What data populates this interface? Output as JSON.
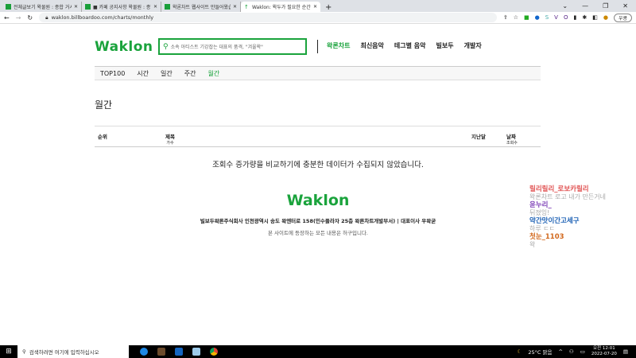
{
  "browser": {
    "tabs": [
      {
        "title": "전체글보기 왁물원 : 종합 거시기"
      },
      {
        "title": "■ 카페 공지사항 왁물원 : 종합"
      },
      {
        "title": "왁론차트 웹사이트 만들어왔습니"
      },
      {
        "title": "Waklon: 왁두가 필요한 순간, 왁"
      }
    ],
    "new_tab": "+",
    "url": "waklon.billboardoo.com/charts/monthly",
    "profile_label": "우콩"
  },
  "site": {
    "logo": "Waklon",
    "search_placeholder": "소속 아티스트 기강잡는 대표의 품격, \"겨울왁\"",
    "nav": [
      "왁론차트",
      "최신음악",
      "테그별 음악",
      "빌보두",
      "개발자"
    ],
    "subnav": [
      "TOP100",
      "시간",
      "일간",
      "주간",
      "월간"
    ],
    "subnav_active": 4,
    "page_title": "월간",
    "table_headers": {
      "rank": "순위",
      "title": "제목",
      "artist": "가수",
      "last": "지난달",
      "date": "날짜",
      "views": "조회수"
    },
    "empty_message": "조회수 증가량을 비교하기에 충분한 데이터가 수집되지 않았습니다.",
    "footer_logo": "Waklon",
    "footer_company": "빌보두왁론주식회사 인천광역시 송도 왁엔터로 158(민수플라자 25층 왁론차트개발부서) | 대표이사 우왁굳",
    "footer_note": "본 사이트에 등장하는 모든 내용은 허구입니다."
  },
  "chat": [
    {
      "name": "릴리릴리_로보카릴리",
      "msg": "왁론차트 로고 내가 만든거네",
      "color": "#e05050"
    },
    {
      "name": "윤누리_",
      "msg": "뒤졌잉!",
      "color": "#7b3db5"
    },
    {
      "name": "약간맛이간고세구",
      "msg": "하루 ㄷㄷ",
      "color": "#1a5fb4"
    },
    {
      "name": "첫눈_1103",
      "msg": "왁",
      "color": "#d2691e"
    }
  ],
  "taskbar": {
    "search_placeholder": "검색하려면 여기에 입력하십시오",
    "weather": "25°C 맑음",
    "time": "오전 12:01",
    "date": "2022-07-20"
  }
}
